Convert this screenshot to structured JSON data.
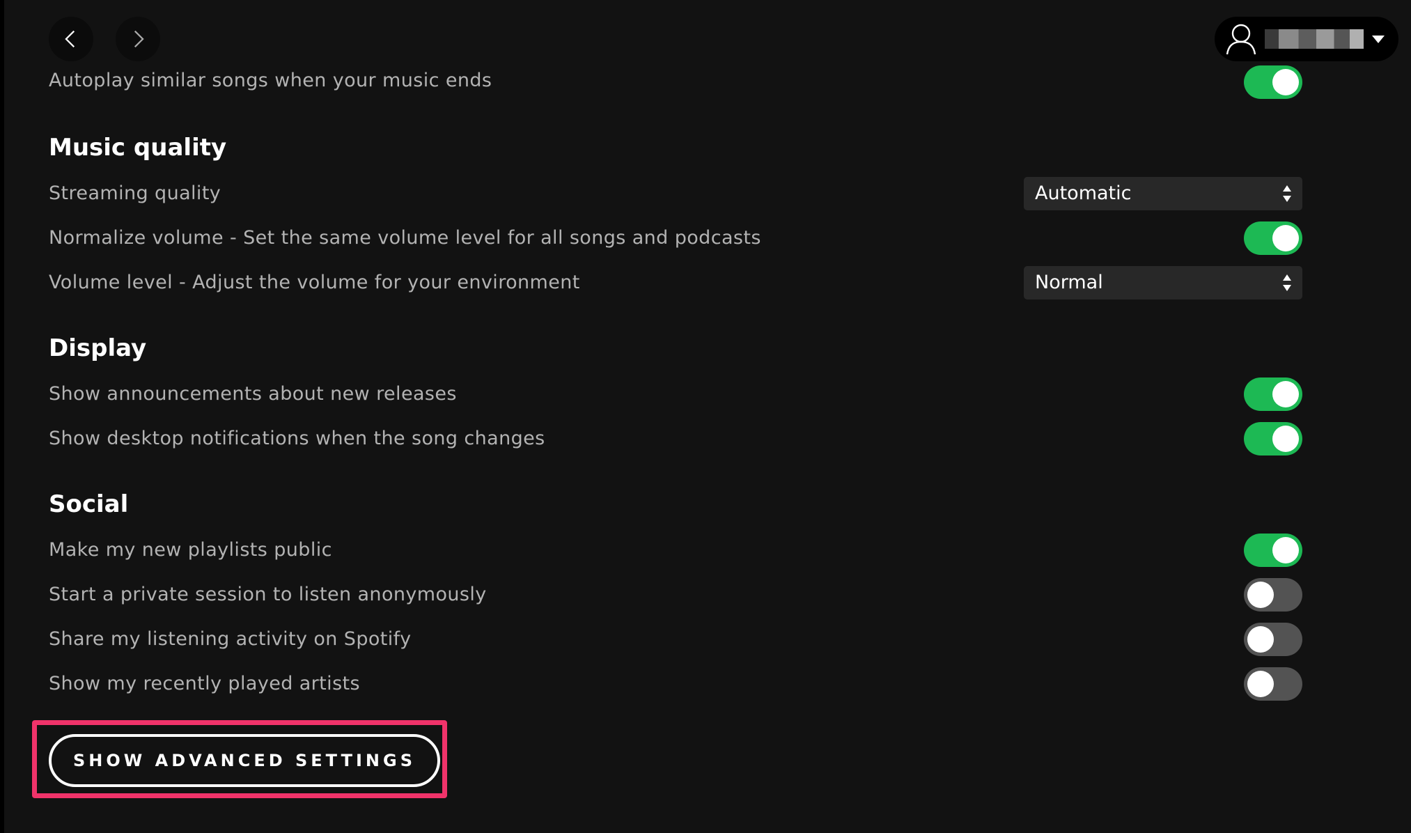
{
  "nav": {
    "back_icon": "chevron-left-icon",
    "forward_icon": "chevron-right-icon"
  },
  "user": {
    "avatar_icon": "user-icon",
    "name_display": "",
    "menu_icon": "caret-down-icon"
  },
  "autoplay": {
    "label": "Autoplay similar songs when your music ends",
    "enabled": true
  },
  "music_quality": {
    "title": "Music quality",
    "streaming_quality": {
      "label": "Streaming quality",
      "value": "Automatic"
    },
    "normalize_volume": {
      "label": "Normalize volume - Set the same volume level for all songs and podcasts",
      "enabled": true
    },
    "volume_level": {
      "label": "Volume level - Adjust the volume for your environment",
      "value": "Normal"
    }
  },
  "display": {
    "title": "Display",
    "announcements": {
      "label": "Show announcements about new releases",
      "enabled": true
    },
    "desktop_notifications": {
      "label": "Show desktop notifications when the song changes",
      "enabled": true
    }
  },
  "social": {
    "title": "Social",
    "public_playlists": {
      "label": "Make my new playlists public",
      "enabled": true
    },
    "private_session": {
      "label": "Start a private session to listen anonymously",
      "enabled": false
    },
    "share_activity": {
      "label": "Share my listening activity on Spotify",
      "enabled": false
    },
    "recent_artists": {
      "label": "Show my recently played artists",
      "enabled": false
    }
  },
  "advanced_button": {
    "label": "SHOW ADVANCED SETTINGS"
  },
  "colors": {
    "background": "#121212",
    "accent_green": "#1db954",
    "toggle_off": "#535353",
    "highlight": "#f0336a"
  }
}
